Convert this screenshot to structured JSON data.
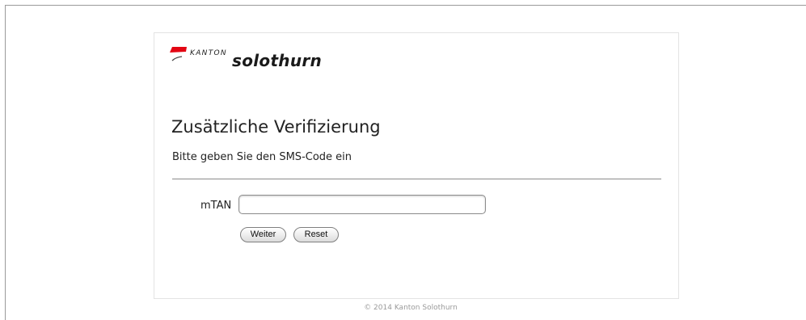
{
  "logo": {
    "kanton": "KANTON",
    "name": "solothurn",
    "brand_color": "#e30613"
  },
  "heading": "Zusätzliche Verifizierung",
  "subtitle": "Bitte geben Sie den SMS-Code ein",
  "form": {
    "mtan_label": "mTAN",
    "mtan_value": "",
    "weiter_label": "Weiter",
    "reset_label": "Reset"
  },
  "footer": "© 2014 Kanton Solothurn"
}
